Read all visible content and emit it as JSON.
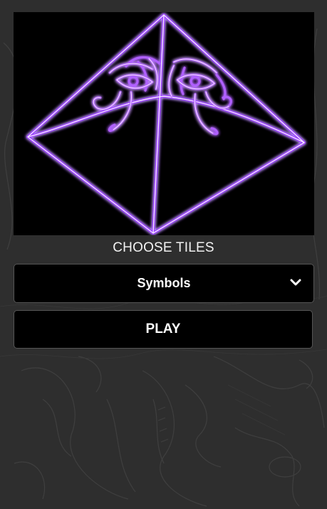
{
  "menu": {
    "choose_label": "CHOOSE TILES",
    "tile_set": {
      "selected": "Symbols"
    },
    "play_label": "PLAY"
  },
  "colors": {
    "background": "#2e2e2e",
    "panel": "#000000",
    "neon_purple": "#a040ff",
    "neon_core": "#f0e0ff",
    "text": "#ffffff"
  },
  "icons": {
    "hero": "neon-pyramid-eye-of-horus",
    "dropdown": "chevron-down-icon"
  }
}
